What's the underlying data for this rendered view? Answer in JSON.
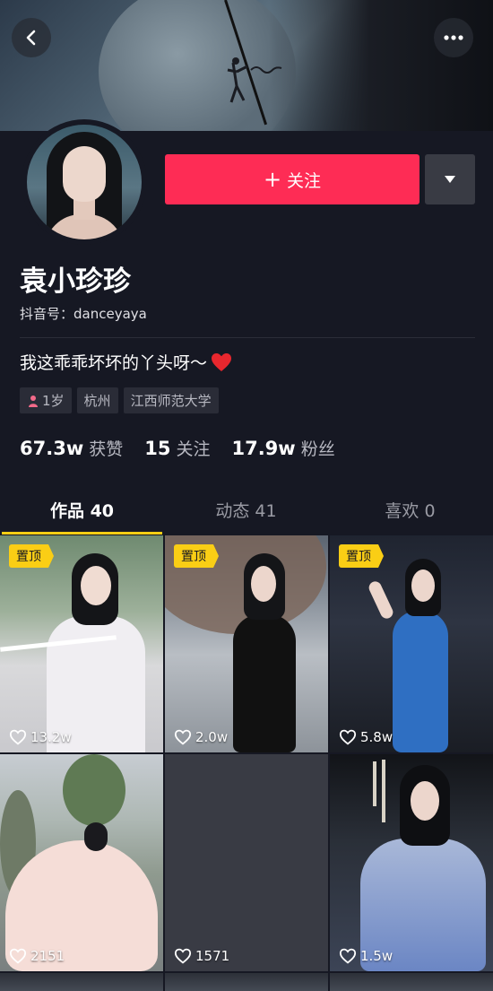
{
  "header": {
    "back_icon": "chevron-left-icon",
    "more_icon": "more-dots-icon"
  },
  "profile": {
    "follow_label": "+ 关注",
    "follow_text": "关注",
    "name": "袁小珍珍",
    "douyin_id": "抖音号：danceyaya",
    "bio": "我这乖乖坏坏的丫头呀～",
    "tags": {
      "age": "1岁",
      "city": "杭州",
      "school": "江西师范大学"
    },
    "stats": [
      {
        "value": "67.3w",
        "label": "获赞"
      },
      {
        "value": "15",
        "label": "关注"
      },
      {
        "value": "17.9w",
        "label": "粉丝"
      }
    ]
  },
  "tabs": [
    {
      "label": "作品 40",
      "active": true
    },
    {
      "label": "动态 41",
      "active": false
    },
    {
      "label": "喜欢 0",
      "active": false
    }
  ],
  "videos": [
    {
      "pinned": true,
      "pin_label": "置顶",
      "likes": "13.2w"
    },
    {
      "pinned": true,
      "pin_label": "置顶",
      "likes": "2.0w"
    },
    {
      "pinned": true,
      "pin_label": "置顶",
      "likes": "5.8w"
    },
    {
      "pinned": false,
      "likes": "2151"
    },
    {
      "pinned": false,
      "likes": "1571"
    },
    {
      "pinned": false,
      "likes": "1.5w"
    }
  ],
  "colors": {
    "background": "#161823",
    "accent": "#fe2c55",
    "tab_indicator": "#face15",
    "pin_badge": "#face15"
  }
}
